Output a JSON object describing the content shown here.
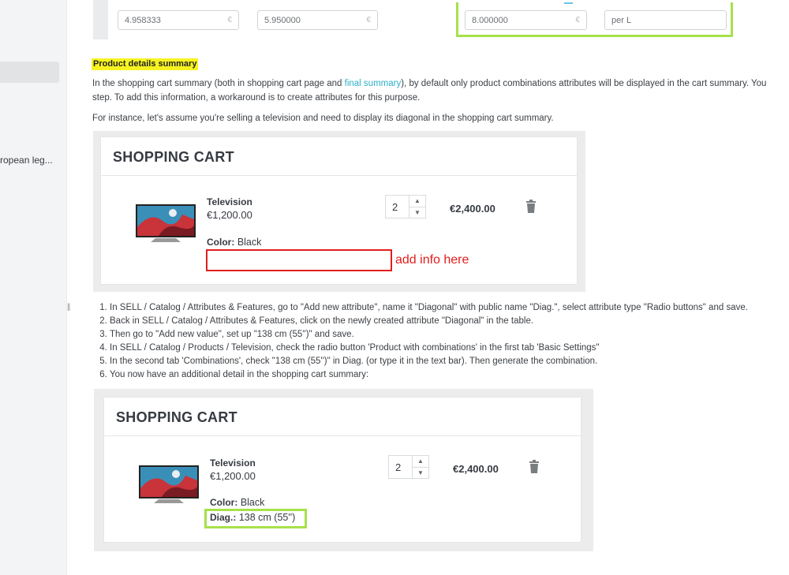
{
  "sidebar": {
    "partial_item": "ropean leg..."
  },
  "price_row": {
    "price_tax_excl": "4.958333",
    "price_tax_incl": "5.950000",
    "unit_price": "8.000000",
    "unit": "per L",
    "currency_symbol": "€"
  },
  "section_title": "Product details summary",
  "intro": {
    "line1_before_link": "In the shopping cart summary (both in shopping cart page and ",
    "link": "final summary",
    "line1_after_link": "), by default only product combinations attributes will be displayed in the cart summary. You",
    "line2": "step. To add this information, a workaround is to create attributes for this purpose.",
    "line3": "For instance, let's assume you're selling a television and need to display its diagonal in the shopping cart summary."
  },
  "cart_before": {
    "title": "SHOPPING CART",
    "product_name": "Television",
    "unit_price": "€1,200.00",
    "attr_label": "Color:",
    "attr_value": "Black",
    "quantity": "2",
    "total": "€2,400.00",
    "annotation": "add info here"
  },
  "steps": [
    "In SELL / Catalog / Attributes & Features, go to \"Add new attribute\", name it \"Diagonal\" with public name \"Diag.\", select attribute type \"Radio buttons\" and save.",
    "Back in SELL / Catalog / Attributes & Features, click on the newly created attribute \"Diagonal\" in the table.",
    "Then go to \"Add new value\", set up \"138 cm (55'')\" and save.",
    "In SELL / Catalog / Products / Television, check the radio button 'Product with combinations' in the first tab 'Basic Settings\"",
    "In the second tab 'Combinations', check \"138 cm (55'')\" in Diag. (or type it in the text bar). Then generate the combination.",
    "You now have an additional detail in the shopping cart summary:"
  ],
  "cart_after": {
    "title": "SHOPPING CART",
    "product_name": "Television",
    "unit_price": "€1,200.00",
    "attr_label": "Color:",
    "attr_value": "Black",
    "diag_label": "Diag.:",
    "diag_value": "138 cm (55'')",
    "quantity": "2",
    "total": "€2,400.00"
  },
  "colors": {
    "highlight": "#f7f321",
    "annotation_red": "#e21d1d",
    "annotation_green": "#a6e14a",
    "link": "#2dafc9"
  }
}
